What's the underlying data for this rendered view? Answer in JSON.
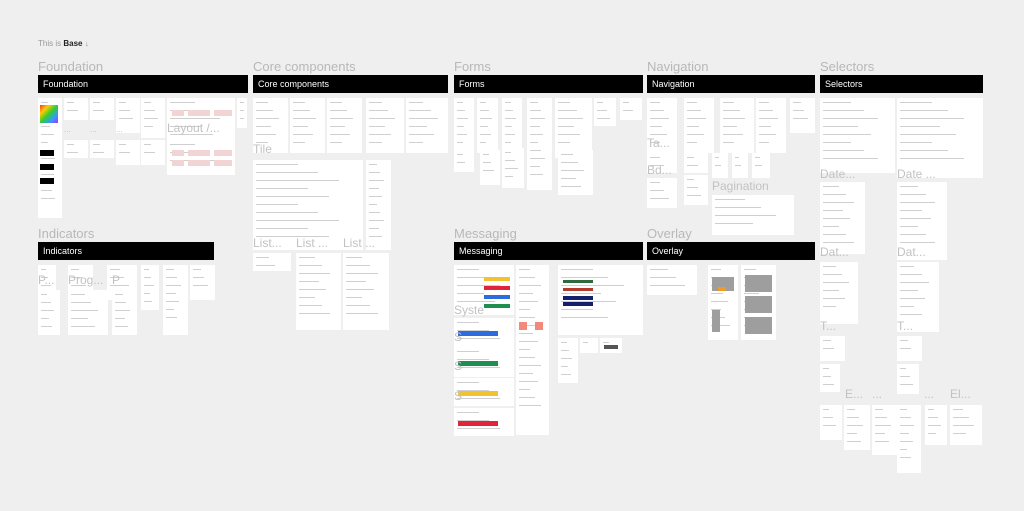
{
  "intro": {
    "prefix": "This is",
    "page": "Base",
    "arrow": "↓"
  },
  "sections": [
    {
      "label": "Foundation",
      "frame_title": "Foundation"
    },
    {
      "label": "Core components",
      "frame_title": "Core components"
    },
    {
      "label": "Forms",
      "frame_title": "Forms"
    },
    {
      "label": "Navigation",
      "frame_title": "Navigation"
    },
    {
      "label": "Selectors",
      "frame_title": "Selectors"
    },
    {
      "label": "Indicators",
      "frame_title": "Indicators"
    },
    {
      "label": "Messaging",
      "frame_title": "Messaging"
    },
    {
      "label": "Overlay",
      "frame_title": "Overlay"
    }
  ],
  "frame_labels": [
    "Layout /...",
    "Tile",
    "List...",
    "List ...",
    "List ...",
    "Ta...",
    "Bd...",
    "Pagination",
    "Date...",
    "Date ...",
    "Dat...",
    "Dat...",
    "T...",
    "T...",
    "E...",
    "...",
    "...",
    "El...",
    "P...",
    "Prog...",
    "P",
    "Syste",
    "S",
    "S",
    "S",
    "...",
    "...",
    "..."
  ],
  "colors": {
    "canvas": "#efefef",
    "bar": "#000000",
    "blue": "#2d6cdf",
    "green": "#1e8f4e",
    "yellow": "#f2c230",
    "red": "#e0243a",
    "pink": "#f3d4d4",
    "navy": "#14206b",
    "gray": "#9e9e9e"
  }
}
